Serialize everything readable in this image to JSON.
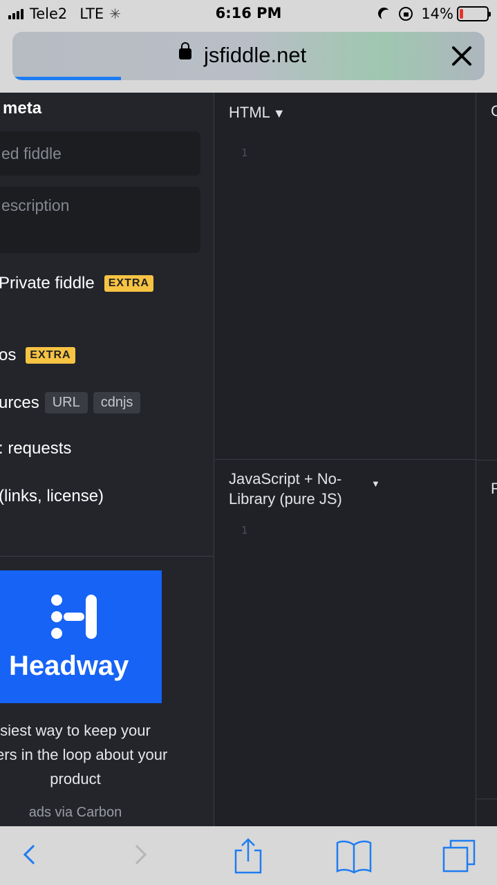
{
  "status_bar": {
    "carrier": "Tele2",
    "network": "LTE",
    "time": "6:16 PM",
    "battery_percent_label": "14%",
    "battery_level": 0.14,
    "battery_color": "#e5342b"
  },
  "browser": {
    "url": "jsfiddle.net",
    "page_load_progress": 0.23,
    "accent_color": "#1e7cf2"
  },
  "sidebar": {
    "heading": "e meta",
    "title_placeholder": "ed fiddle",
    "description_placeholder": "escription",
    "private_label": "Private fiddle",
    "private_badge": "EXTRA",
    "groups_label": "os",
    "groups_badge": "EXTRA",
    "resources_label": "urces",
    "resources_tags": [
      "URL",
      "cdnjs"
    ],
    "ajax_label": ": requests",
    "other_label": " (links, license)"
  },
  "ad": {
    "brand": "Headway",
    "copy_line1": "siest way to keep your",
    "copy_line2": "mers in the loop about your",
    "copy_line3": "product",
    "via": "ads via Carbon",
    "bg_color": "#1663f6"
  },
  "editors": {
    "html": {
      "title": "HTML",
      "caret": "▼",
      "line_number": "1"
    },
    "js": {
      "title_line1": "JavaScript + No-",
      "title_line2": "Library (pure JS)",
      "caret": "▼",
      "line_number": "1"
    },
    "css_title_clip": "C",
    "result_title_clip": "R"
  },
  "toolbar": {
    "icons": [
      "back-icon",
      "forward-icon",
      "share-icon",
      "bookmarks-icon",
      "tabs-icon"
    ]
  }
}
